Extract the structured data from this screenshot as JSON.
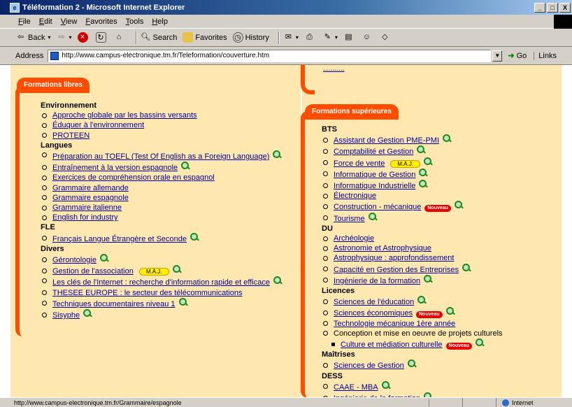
{
  "window": {
    "title": "Téléformation 2 - Microsoft Internet Explorer",
    "min": "_",
    "max": "□",
    "close": "X"
  },
  "menu": [
    "File",
    "Edit",
    "View",
    "Favorites",
    "Tools",
    "Help"
  ],
  "toolbar": {
    "back": "Back",
    "search": "Search",
    "favorites": "Favorites",
    "history": "History"
  },
  "address": {
    "label": "Address",
    "url": "http://www.campus-electronique.tm.fr/Teleformation/couverture.htm",
    "go": "Go",
    "links": "Links"
  },
  "page": {
    "top_partial": "...........",
    "left": {
      "tab": "Formations libres",
      "groups": [
        {
          "heading": "Environnement",
          "items": [
            {
              "text": "Approche globale par les bassins versants"
            },
            {
              "text": "Éduquer à l'environnement"
            },
            {
              "text": "PROTEEN"
            }
          ]
        },
        {
          "heading": "Langues",
          "items": [
            {
              "text": "Préparation au TOEFL (Test Of English as a Foreign Language)",
              "mag": true,
              "wrap": true
            },
            {
              "text": "Entraînement à la version espagnole",
              "mag": true
            },
            {
              "text": "Exercices de compréhension orale en espagnol"
            },
            {
              "text": "Grammaire allemande"
            },
            {
              "text": "Grammaire espagnole"
            },
            {
              "text": "Grammaire italienne"
            },
            {
              "text": "English for industry"
            }
          ]
        },
        {
          "heading": "FLE",
          "items": [
            {
              "text": "Français Langue Étrangère et Seconde",
              "mag": true
            }
          ]
        },
        {
          "heading": "Divers",
          "items": [
            {
              "text": "Gérontologie",
              "mag": true
            },
            {
              "text": "Gestion de l'association",
              "maj": "M.À.J.",
              "mag": true
            },
            {
              "text": "Les clés de l'Internet : recherche d'information rapide et efficace",
              "mag": true,
              "wrap": true
            },
            {
              "text": "THESEE EUROPE : le secteur des télécommunications"
            },
            {
              "text": "Techniques documentaires niveau 1",
              "mag": true
            },
            {
              "text": "Sisyphe",
              "mag": true
            }
          ]
        }
      ]
    },
    "right": {
      "tab": "Formations supérieures",
      "groups": [
        {
          "heading": "BTS",
          "items": [
            {
              "text": "Assistant de Gestion PME-PMI",
              "mag": true
            },
            {
              "text": "Comptabilité et Gestion",
              "mag": true
            },
            {
              "text": "Force de vente",
              "maj": "M.À.J.",
              "mag": true
            },
            {
              "text": "Informatique de Gestion",
              "mag": true
            },
            {
              "text": "Informatique Industrielle",
              "mag": true
            },
            {
              "text": "Électronique"
            },
            {
              "text": "Construction - mécanique",
              "nouv": "Nouveau",
              "mag": true
            },
            {
              "text": "Tourisme",
              "mag": true
            }
          ]
        },
        {
          "heading": "DU",
          "items": [
            {
              "text": "Archéologie"
            },
            {
              "text": "Astronomie et Astrophysique"
            },
            {
              "text": "Astrophysique : approfondissement"
            },
            {
              "text": "Capacité en Gestion des Entreprises",
              "mag": true
            },
            {
              "text": "Ingénierie de la formation",
              "mag": true
            }
          ]
        },
        {
          "heading": "Licences",
          "items": [
            {
              "text": "Sciences de l'éducation",
              "mag": true
            },
            {
              "text": "Sciences économiques",
              "nouv": "Nouveau",
              "mag": true
            },
            {
              "text": "Technologie mécanique 1ère année"
            },
            {
              "text": "Conception et mise en oeuvre de projets culturels",
              "plain": true
            },
            {
              "text": "Culture et médiation culturelle",
              "nouv": "Nouveau",
              "mag": true,
              "sub": true
            }
          ]
        },
        {
          "heading": "Maîtrises",
          "items": [
            {
              "text": "Sciences de Gestion",
              "mag": true
            }
          ]
        },
        {
          "heading": "DESS",
          "items": [
            {
              "text": "CAAE - MBA",
              "mag": true
            },
            {
              "text": "Ingénierie de la formation",
              "mag": true
            }
          ]
        }
      ]
    }
  },
  "status": {
    "text": "http://www.campus-electronique.tm.fr/Grammaire/espagnole",
    "zone": "Internet"
  }
}
